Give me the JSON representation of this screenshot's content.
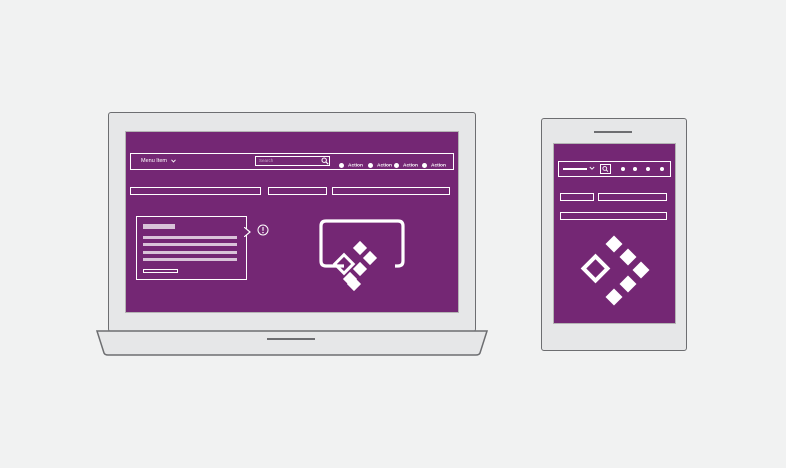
{
  "laptop": {
    "nav": {
      "menu_label": "Menu Item",
      "search_placeholder": "Search",
      "actions": [
        "Action",
        "Action",
        "Action",
        "Action"
      ]
    },
    "screen_color": "#742774"
  },
  "tablet": {
    "screen_color": "#742774"
  },
  "colors": {
    "background": "#f1f2f2",
    "device_body": "#e6e7e8",
    "device_outline": "#6d6e71",
    "accent": "#742774",
    "foreground": "#ffffff"
  }
}
